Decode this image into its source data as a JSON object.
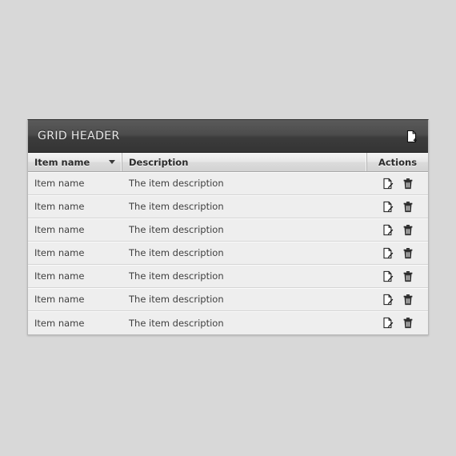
{
  "page": {
    "background_color": "#d8d8d8"
  },
  "grid": {
    "titlebar": {
      "title": "GRID HEADER",
      "add_icon": "add-document-icon",
      "add_tooltip": "Add"
    },
    "columns": [
      {
        "key": "item_name",
        "label": "Item name",
        "sorted": true,
        "sort_direction": "desc",
        "sort_icon": "triangle-down-icon"
      },
      {
        "key": "description",
        "label": "Description",
        "sorted": false
      },
      {
        "key": "actions",
        "label": "Actions",
        "sorted": false
      }
    ],
    "row_actions": [
      {
        "key": "edit",
        "icon": "edit-document-icon",
        "label": "Edit"
      },
      {
        "key": "delete",
        "icon": "trash-icon",
        "label": "Delete"
      }
    ],
    "rows": [
      {
        "item_name": "Item name",
        "description": "The item description"
      },
      {
        "item_name": "Item name",
        "description": "The item description"
      },
      {
        "item_name": "Item name",
        "description": "The item description"
      },
      {
        "item_name": "Item name",
        "description": "The item description"
      },
      {
        "item_name": "Item name",
        "description": "The item description"
      },
      {
        "item_name": "Item name",
        "description": "The item description"
      },
      {
        "item_name": "Item name",
        "description": "The item description"
      }
    ],
    "colors": {
      "titlebar_top": "#5a5a5a",
      "titlebar_bottom": "#343434",
      "title_text": "#e9e9e9",
      "column_header_bg": "#e2e2e2",
      "row_bg": "#eeeeee",
      "row_border": "#d5d5d5",
      "cell_text": "#3f3f3f",
      "grid_border": "#b9b9b9"
    }
  }
}
